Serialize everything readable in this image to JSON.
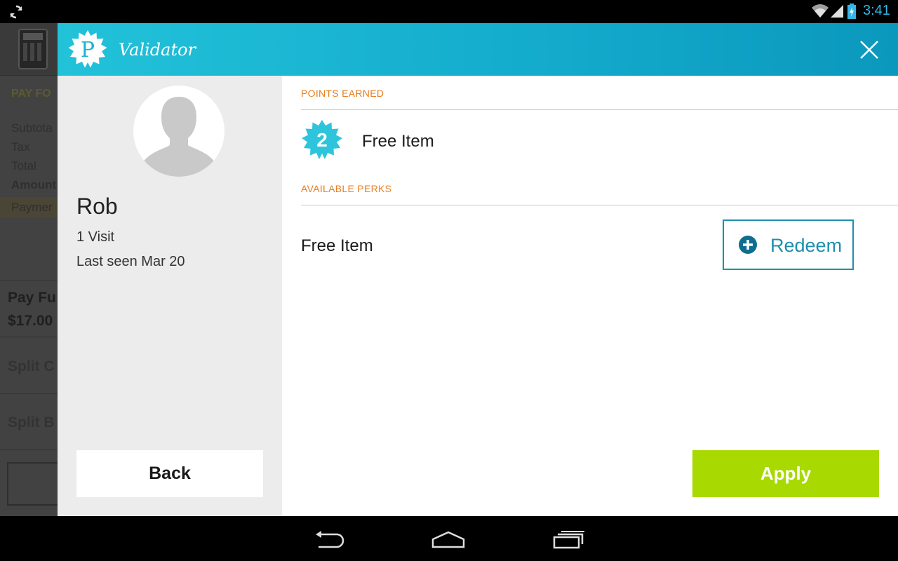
{
  "status_bar": {
    "time": "3:41",
    "icons": [
      "sync-icon",
      "wifi-icon",
      "signal-icon",
      "battery-charging-icon"
    ]
  },
  "background_app": {
    "pay_for": "PAY FO",
    "subtotal": "Subtota",
    "tax": "Tax",
    "total": "Total",
    "amount": "Amount",
    "payment": "Paymer",
    "pay_full": "Pay Fu",
    "pay_amount": "$17.00",
    "split1": "Split C",
    "split2": "Split B"
  },
  "header": {
    "logo_letter": "P",
    "title": "Validator",
    "colors": {
      "gradient_start": "#22c2d9",
      "gradient_end": "#0b98bd"
    }
  },
  "profile": {
    "name": "Rob",
    "visits": "1 Visit",
    "last_seen": "Last seen Mar 20",
    "back_label": "Back"
  },
  "points": {
    "section_label": "POINTS EARNED",
    "badge_value": "2",
    "item": "Free Item"
  },
  "perks": {
    "section_label": "AVAILABLE PERKS",
    "items": [
      {
        "name": "Free Item",
        "action": "Redeem"
      }
    ]
  },
  "apply_label": "Apply",
  "colors": {
    "accent_orange": "#e67e22",
    "accent_teal": "#1e8fb0",
    "badge_cyan": "#2ec4dc",
    "apply_green": "#a8d900"
  },
  "navbar": {
    "icons": [
      "back-nav-icon",
      "home-nav-icon",
      "recents-nav-icon"
    ]
  }
}
